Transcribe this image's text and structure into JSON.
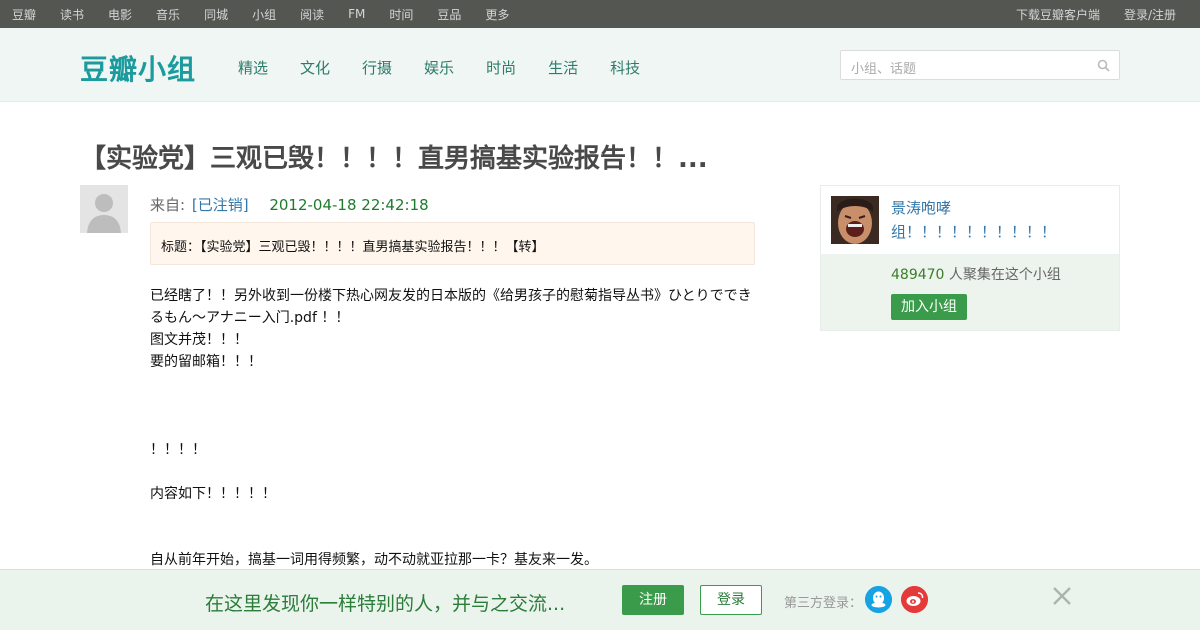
{
  "topnav": {
    "left": [
      "豆瓣",
      "读书",
      "电影",
      "音乐",
      "同城",
      "小组",
      "阅读",
      "FM",
      "时间",
      "豆品",
      "更多"
    ],
    "right": [
      "下载豆瓣客户端",
      "登录/注册"
    ]
  },
  "header": {
    "logo": "豆瓣小组",
    "categories": [
      "精选",
      "文化",
      "行摄",
      "娱乐",
      "时尚",
      "生活",
      "科技"
    ],
    "search_placeholder": "小组、话题"
  },
  "post": {
    "title": "【实验党】三观已毁！！！！直男搞基实验报告！！...",
    "from_label": "来自:",
    "author": "[已注销]",
    "time": "2012-04-18 22:42:18",
    "subject": "标题：【实验党】三观已毁！！！！直男搞基实验报告！！！【转】",
    "content": [
      "已经瞎了！！另外收到一份楼下热心网友发的日本版的《给男孩子的慰菊指导丛书》ひとりでできるもん～アナニー入门.pdf ！！",
      "图文并茂！！！",
      "要的留邮箱！！！",
      "",
      "",
      "",
      "！！！！",
      "",
      "内容如下！！！！！",
      "",
      "",
      "自从前年开始，搞基一词用得频繁，动不动就亚拉那一卡？基友来一发。"
    ]
  },
  "group": {
    "name": "景涛咆哮组！！！！！！！！！！",
    "members_count": "489470",
    "members_suffix": "人聚集在这个小组",
    "join_label": "加入小组"
  },
  "banner": {
    "slogan": "在这里发现你一样特别的人，并与之交流...",
    "register": "注册",
    "login": "登录",
    "third_party": "第三方登录："
  },
  "colors": {
    "topbar": "#545652",
    "header_bg": "#f0f6f3",
    "logo": "#1b9b9e",
    "link": "#3377aa",
    "green": "#3a9b4b"
  }
}
